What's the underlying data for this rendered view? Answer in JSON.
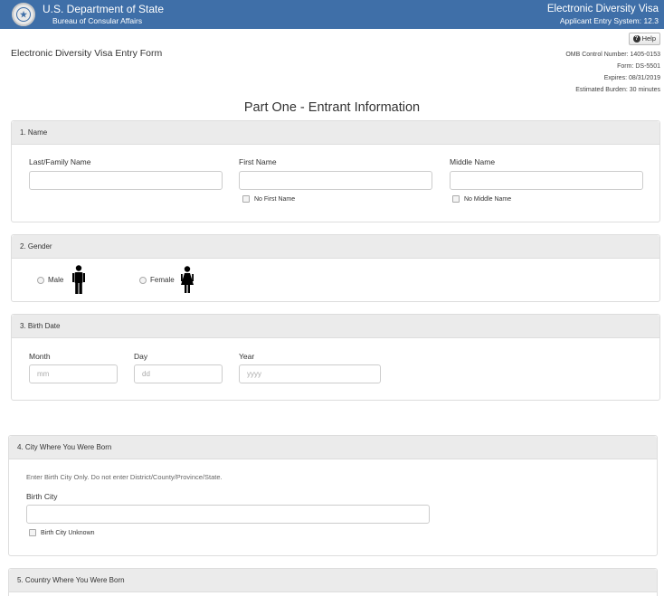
{
  "header": {
    "department": "U.S. Department of State",
    "bureau": "Bureau of Consular Affairs",
    "program": "Electronic Diversity Visa",
    "system": "Applicant Entry System: 12.3"
  },
  "help_label": "Help",
  "form_title": "Electronic Diversity Visa Entry Form",
  "omb": {
    "control": "OMB Control Number: 1405-0153",
    "form": "Form: DS-5501",
    "expires": "Expires: 08/31/2019",
    "burden": "Estimated Burden: 30 minutes"
  },
  "part_title": "Part One - Entrant Information",
  "name_section": {
    "heading": "1. Name",
    "last_label": "Last/Family Name",
    "first_label": "First Name",
    "middle_label": "Middle Name",
    "last_value": "",
    "first_value": "",
    "middle_value": "",
    "no_first": "No First Name",
    "no_middle": "No Middle Name"
  },
  "gender_section": {
    "heading": "2. Gender",
    "male": "Male",
    "female": "Female"
  },
  "birth_section": {
    "heading": "3. Birth Date",
    "month_label": "Month",
    "day_label": "Day",
    "year_label": "Year",
    "month_placeholder": "mm",
    "day_placeholder": "dd",
    "year_placeholder": "yyyy"
  },
  "city_section": {
    "heading": "4. City Where You Were Born",
    "hint": "Enter Birth City Only. Do not enter District/County/Province/State.",
    "label": "Birth City",
    "value": "",
    "unknown": "Birth City Unknown"
  },
  "country_section": {
    "heading": "5. Country Where You Were Born"
  }
}
